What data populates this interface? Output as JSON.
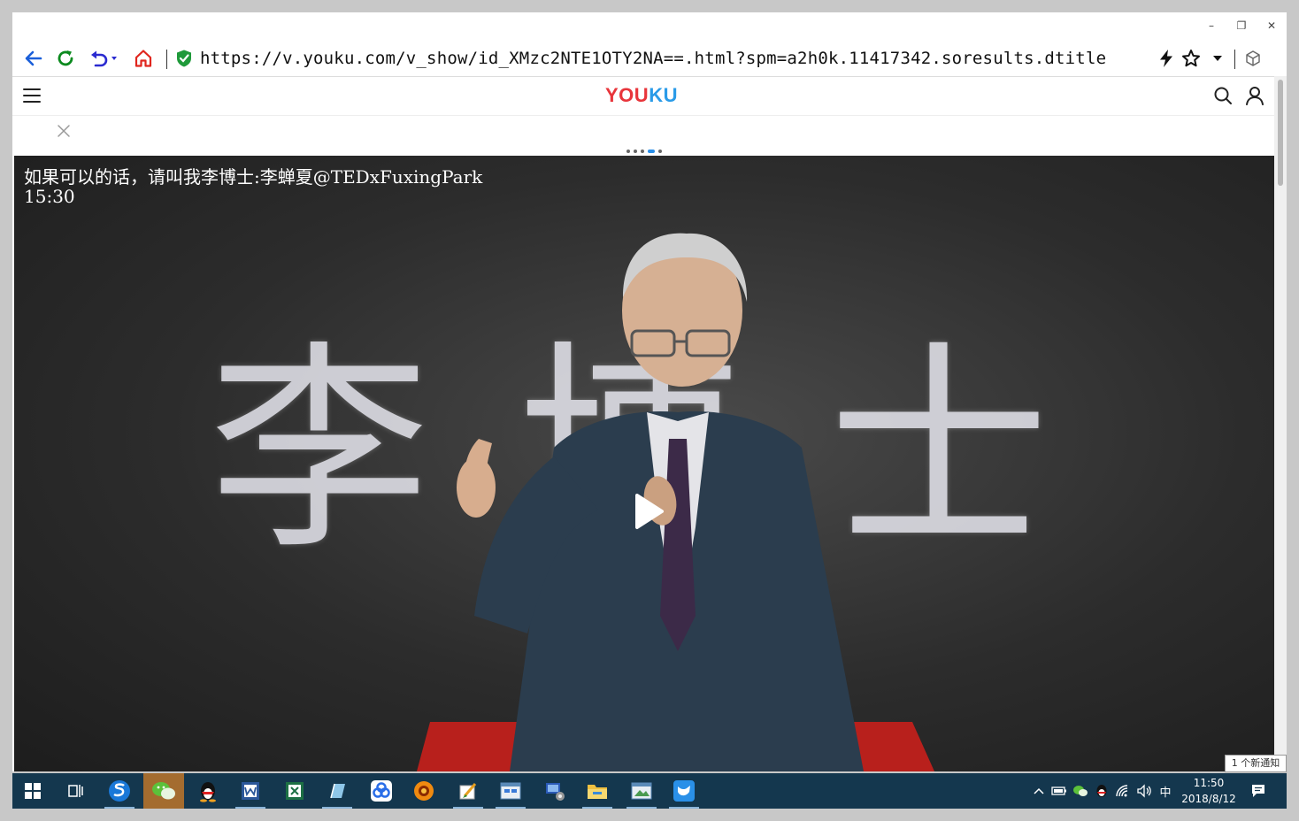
{
  "browser": {
    "url": "https://v.youku.com/v_show/id_XMzc2NTE1OTY2NA==.html?spm=a2h0k.11417342.soresults.dtitle"
  },
  "youku": {
    "logo_parts": [
      "YOU",
      "KU"
    ],
    "logo_colors": [
      "#e8353b",
      "#2a9be8"
    ]
  },
  "video": {
    "title": "如果可以的话，请叫我李博士:李蝉夏@TEDxFuxingPark",
    "duration": "15:30",
    "stage_chars": [
      "李",
      "博",
      "士"
    ]
  },
  "notification": {
    "text": "1 个新通知"
  },
  "taskbar": {
    "tray_ime": "中",
    "time": "11:50",
    "date": "2018/8/12"
  },
  "colors": {
    "nav_blue": "#1b5fd9",
    "reload_green": "#0b8a1e",
    "home_red": "#e0261e",
    "shield_green": "#1f9a3a",
    "taskbar_bg": "#14374e"
  }
}
